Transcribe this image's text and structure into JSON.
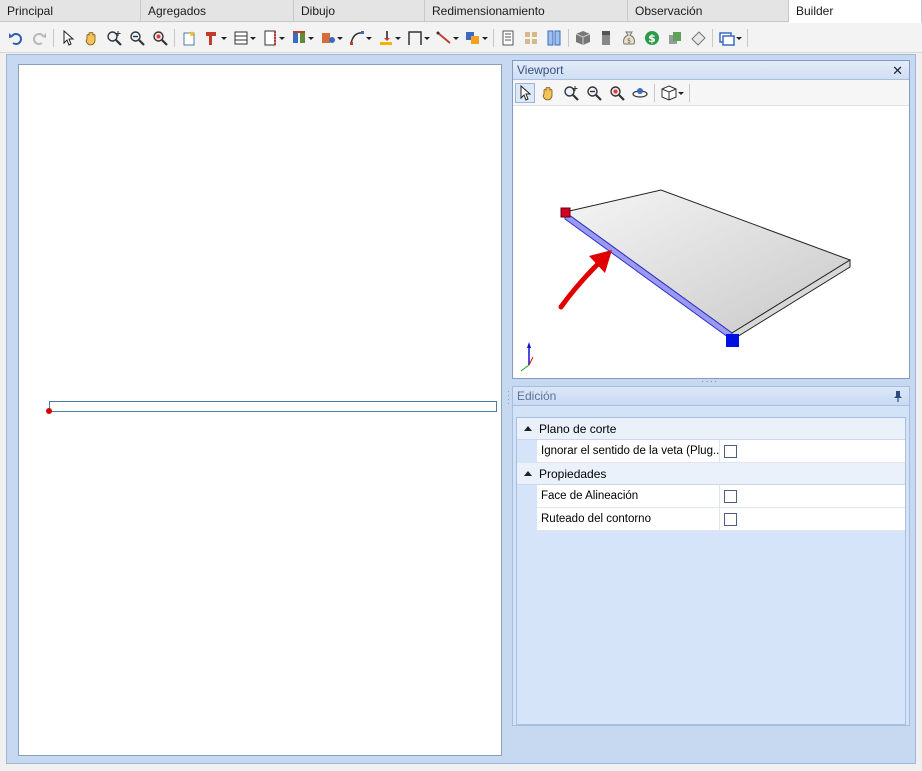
{
  "tabs": [
    {
      "label": "Principal",
      "active": false
    },
    {
      "label": "Agregados",
      "active": false
    },
    {
      "label": "Dibujo",
      "active": false
    },
    {
      "label": "Redimensionamiento",
      "active": false
    },
    {
      "label": "Observación",
      "active": false
    },
    {
      "label": "Builder",
      "active": true
    }
  ],
  "toolbar_icons": [
    "undo-icon",
    "redo-icon",
    "select-icon",
    "pan-icon",
    "zoom-extents-icon",
    "zoom-out-icon",
    "zoom-window-icon",
    "new-sketch-icon",
    "tool-icon",
    "shelf-icon",
    "door-icon",
    "edge-band-icon",
    "hinge-icon",
    "curve-icon",
    "drill-icon",
    "frame-icon",
    "line-icon",
    "copy-icon",
    "report-icon",
    "grid-icon",
    "split-icon",
    "box-icon",
    "panel-icon",
    "money-bag-icon",
    "dollar-icon",
    "material-icon",
    "label-icon",
    "window-icon"
  ],
  "viewport": {
    "title": "Viewport",
    "close_glyph": "✕",
    "tools": [
      "select-icon",
      "pan-icon",
      "zoom-extents-icon",
      "zoom-out-icon",
      "zoom-window-icon",
      "orbit-icon",
      "cube-view-icon"
    ]
  },
  "edicion": {
    "title": "Edición",
    "sections": [
      {
        "label": "Plano de corte",
        "rows": [
          {
            "name": "Ignorar el sentido de la veta (Plug...",
            "checked": false
          }
        ]
      },
      {
        "label": "Propiedades",
        "rows": [
          {
            "name": "Face de Alineación",
            "checked": false
          },
          {
            "name": "Ruteado del contorno",
            "checked": false
          }
        ]
      }
    ]
  },
  "colors": {
    "accent": "#c7d9f1",
    "edge_highlight": "#4040e0",
    "handle_red": "#d4002a",
    "handle_blue": "#0010e0",
    "arrow": "#e00000"
  }
}
